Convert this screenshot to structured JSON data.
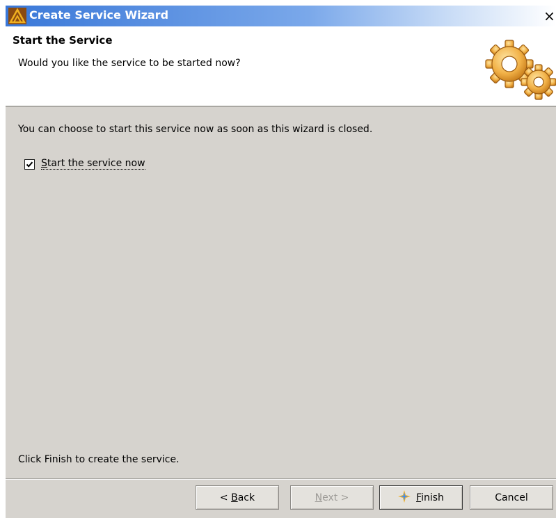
{
  "window": {
    "title": "Create Service Wizard",
    "close_glyph": "×",
    "app_icon": "wizard-app-icon"
  },
  "header": {
    "title": "Start the Service",
    "subtitle": "Would you like the service to be started now?",
    "icon": "gears-icon"
  },
  "body": {
    "description": "You can choose to start this service now as soon as this wizard is closed.",
    "checkbox": {
      "label_underlined": "S",
      "label_rest": "tart the service now",
      "checked": true
    },
    "footer_text": "Click Finish to create the service."
  },
  "buttons": {
    "back": {
      "prefix": "< ",
      "underlined": "B",
      "rest": "ack",
      "enabled": true
    },
    "next": {
      "underlined": "N",
      "rest": "ext >",
      "enabled": false
    },
    "finish": {
      "underlined": "F",
      "rest": "inish",
      "icon": "sparkle-icon",
      "enabled": true
    },
    "cancel": {
      "label": "Cancel",
      "enabled": true
    }
  },
  "colors": {
    "titlebar_start": "#3a78d8",
    "dialog_bg": "#d6d3ce",
    "gear_orange": "#f0a030"
  }
}
